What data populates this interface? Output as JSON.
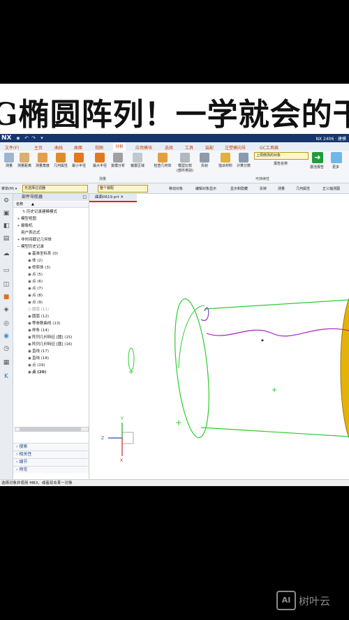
{
  "banner": {
    "title": "G椭圆阵列！一学就会的干"
  },
  "titlebar": {
    "app": "NX",
    "right_text": "NX 2406 · 建模"
  },
  "menu_tabs": [
    "文件(F)",
    "主页",
    "曲线",
    "曲面",
    "视图",
    "分析",
    "应用模块",
    "选择",
    "工具",
    "装配",
    "注塑模向导",
    "GC工具箱"
  ],
  "ribbon": {
    "buttons": [
      "测量",
      "测量距离",
      "测量角度",
      "几何属性",
      "最小半径",
      "最大半径",
      "拔模分析",
      "偏置区域",
      "检查几何体",
      "模型比较(部件类别)",
      "反射",
      "指派材料",
      "计算分数"
    ],
    "group_measure": "测量",
    "group_check": "可持续性",
    "dropdown": "上周修改的对象",
    "report_label": "报告名称",
    "activate_label": "激活报告",
    "more_label": "更多"
  },
  "toolbar": {
    "menu": "菜单(M) ▾",
    "filter": "无选择过滤器",
    "scope": "整个装配",
    "items": [
      "移动对象",
      "编辑对象显示",
      "显示和隐藏",
      "反转",
      "测量",
      "几何属性",
      "正三轴测图"
    ]
  },
  "navigator": {
    "title": "部件导航器",
    "col_name": "名称",
    "rows": [
      {
        "label": "历史记录建模模式",
        "glyph": "↻",
        "indent": 1
      },
      {
        "label": "模型视图",
        "glyph": "+",
        "indent": 0
      },
      {
        "label": "摄像机",
        "glyph": "+",
        "indent": 0
      },
      {
        "label": "用户表达式",
        "glyph": "",
        "indent": 0
      },
      {
        "label": "非时间戳记几何体",
        "glyph": "+",
        "indent": 0
      },
      {
        "label": "模型历史记录",
        "glyph": "−",
        "indent": 0
      },
      {
        "label": "基准坐标系 (0)",
        "glyph": "◉",
        "indent": 2
      },
      {
        "label": "体 (2)",
        "glyph": "◉",
        "indent": 2
      },
      {
        "label": "修剪体 (3)",
        "glyph": "◉",
        "indent": 2
      },
      {
        "label": "点 (5)",
        "glyph": "◉",
        "indent": 2
      },
      {
        "label": "点 (6)",
        "glyph": "◉",
        "indent": 2
      },
      {
        "label": "点 (7)",
        "glyph": "◉",
        "indent": 2
      },
      {
        "label": "点 (8)",
        "glyph": "◉",
        "indent": 2
      },
      {
        "label": "点 (9)",
        "glyph": "◉",
        "indent": 2
      },
      {
        "label": "圆弧 (11)",
        "glyph": "◌",
        "indent": 2,
        "dim": true
      },
      {
        "label": "圆弧 (12)",
        "glyph": "◉",
        "indent": 2
      },
      {
        "label": "等参数曲线 (13)",
        "glyph": "◉",
        "indent": 2
      },
      {
        "label": "样条 (14)",
        "glyph": "◉",
        "indent": 2
      },
      {
        "label": "阵列几何特征 [圆] (15)",
        "glyph": "◉",
        "indent": 2
      },
      {
        "label": "阵列几何特征 [圆] (16)",
        "glyph": "◉",
        "indent": 2
      },
      {
        "label": "直线 (17)",
        "glyph": "◉",
        "indent": 2
      },
      {
        "label": "直线 (18)",
        "glyph": "◉",
        "indent": 2
      },
      {
        "label": "点 (19)",
        "glyph": "◉",
        "indent": 2
      },
      {
        "label": "点 (20)",
        "glyph": "◉",
        "indent": 2,
        "bold": true
      }
    ],
    "panels": [
      "搜索",
      "相关性",
      "细节",
      "预览"
    ]
  },
  "doc_tab": "曲面0619.prt",
  "statusbar": "选择对象并使用 MB3，或者双击某一对象",
  "triad": {
    "x": "X",
    "y": "Y",
    "z": "Z"
  },
  "watermark": {
    "logo": "AI",
    "text": "树叶云"
  },
  "colors": {
    "accent": "#16356b",
    "curve": "#2ecc2e",
    "spline": "#a020c0",
    "body": "#e0b000"
  },
  "icons": [
    "undo-icon",
    "redo-icon",
    "save-icon",
    "search-icon",
    "tree-icon",
    "axis-triad-icon"
  ]
}
